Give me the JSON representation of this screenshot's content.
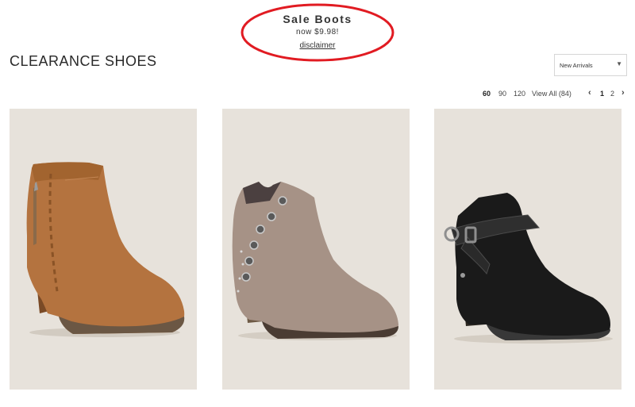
{
  "promo": {
    "title": "Sale Boots",
    "subtitle": "now $9.98!",
    "link": "disclaimer",
    "oval_color": "#e11b22"
  },
  "page": {
    "title": "CLEARANCE SHOES"
  },
  "sort": {
    "selected": "New Arrivals"
  },
  "pagination": {
    "sizes": [
      "60",
      "90",
      "120"
    ],
    "view_all": "View All (84)",
    "pages": [
      "1",
      "2"
    ],
    "current_page": "1"
  },
  "products": [
    {
      "name": "cognac suede ankle boot",
      "color": "#b4733f",
      "icon": "boot"
    },
    {
      "name": "taupe grommet ankle boot",
      "color": "#a69286",
      "icon": "boot"
    },
    {
      "name": "black harness ankle boot",
      "color": "#1a1a1a",
      "icon": "boot"
    }
  ]
}
